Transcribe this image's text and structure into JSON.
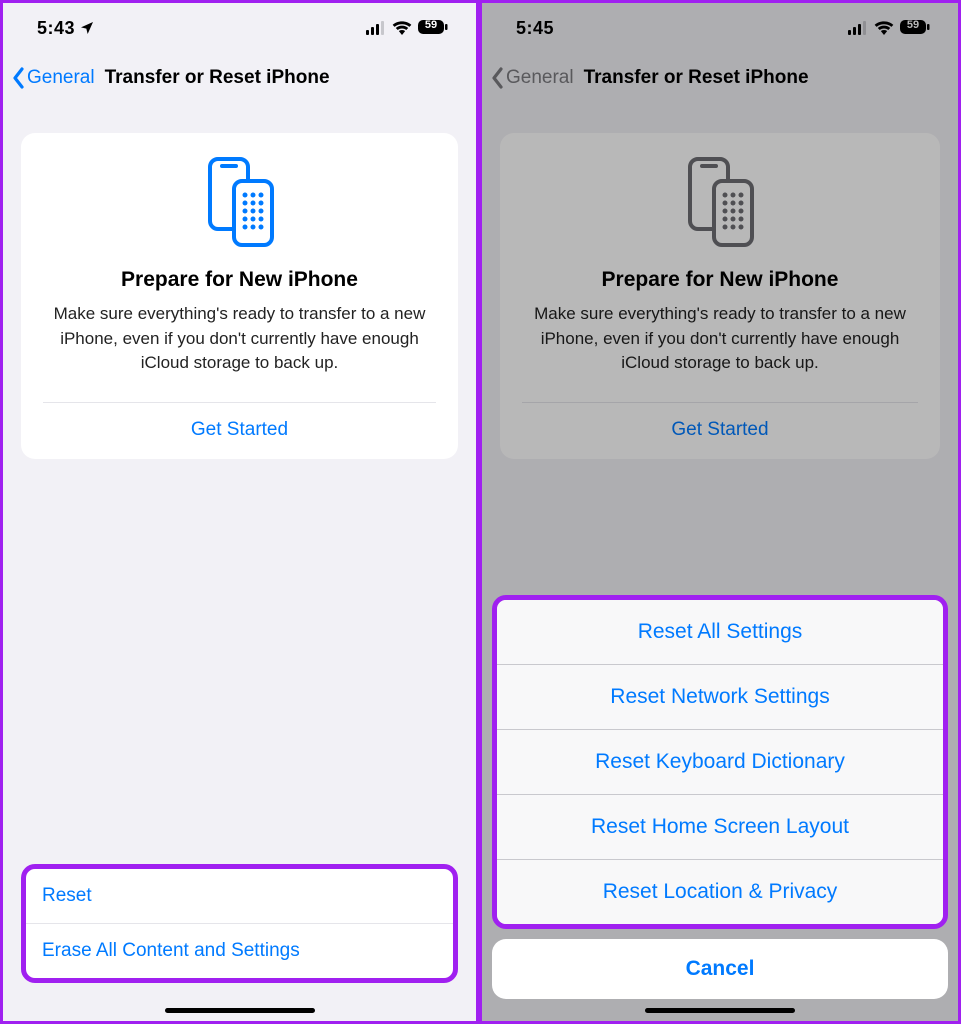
{
  "left": {
    "time": "5:43",
    "battery": "59",
    "back_label": "General",
    "title": "Transfer or Reset iPhone",
    "card": {
      "title": "Prepare for New iPhone",
      "desc": "Make sure everything's ready to transfer to a new iPhone, even if you don't currently have enough iCloud storage to back up.",
      "cta": "Get Started"
    },
    "bottom": {
      "reset": "Reset",
      "erase": "Erase All Content and Settings"
    }
  },
  "right": {
    "time": "5:45",
    "battery": "59",
    "back_label": "General",
    "title": "Transfer or Reset iPhone",
    "card": {
      "title": "Prepare for New iPhone",
      "desc": "Make sure everything's ready to transfer to a new iPhone, even if you don't currently have enough iCloud storage to back up.",
      "cta": "Get Started"
    },
    "sheet": {
      "items": [
        "Reset All Settings",
        "Reset Network Settings",
        "Reset Keyboard Dictionary",
        "Reset Home Screen Layout",
        "Reset Location & Privacy"
      ],
      "cancel": "Cancel"
    }
  }
}
